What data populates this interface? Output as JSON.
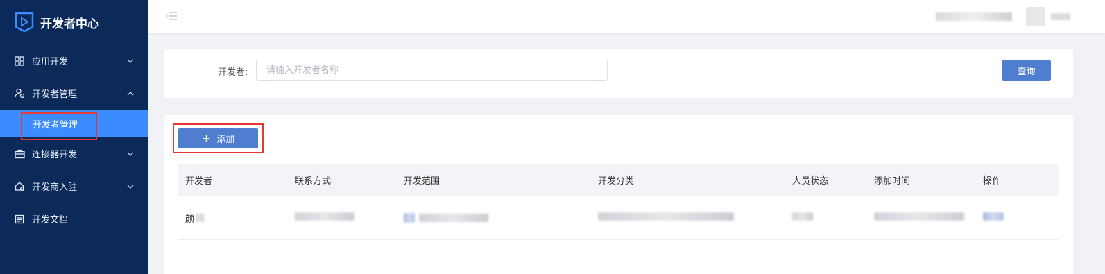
{
  "sidebar": {
    "logo_title": "开发者中心",
    "items": [
      {
        "label": "应用开发",
        "icon": "grid-icon",
        "arrow": "chevron-down-icon"
      },
      {
        "label": "开发者管理",
        "icon": "user-gear-icon",
        "arrow": "chevron-up-icon"
      },
      {
        "label": "连接器开发",
        "icon": "briefcase-icon",
        "arrow": "chevron-down-icon"
      },
      {
        "label": "开发商入驻",
        "icon": "home-settings-icon",
        "arrow": "chevron-down-icon"
      },
      {
        "label": "开发文档",
        "icon": "document-icon"
      }
    ],
    "active_sub": {
      "label": "开发者管理"
    }
  },
  "header": {
    "collapse_icon": "menu-fold-icon"
  },
  "search": {
    "label": "开发者:",
    "placeholder": "请输入开发者名称",
    "value": "",
    "query_label": "查询"
  },
  "toolbar": {
    "add_label": "添加"
  },
  "table": {
    "headers": [
      "开发者",
      "联系方式",
      "开发范围",
      "开发分类",
      "人员状态",
      "添加时间",
      "操作"
    ],
    "rows": [
      {
        "developer_prefix": "颜"
      }
    ]
  },
  "colors": {
    "sidebar_bg": "#0b2a5a",
    "active_item_bg": "#3b8cff",
    "primary_button": "#4f7ed0",
    "highlight_border": "#e53935"
  }
}
